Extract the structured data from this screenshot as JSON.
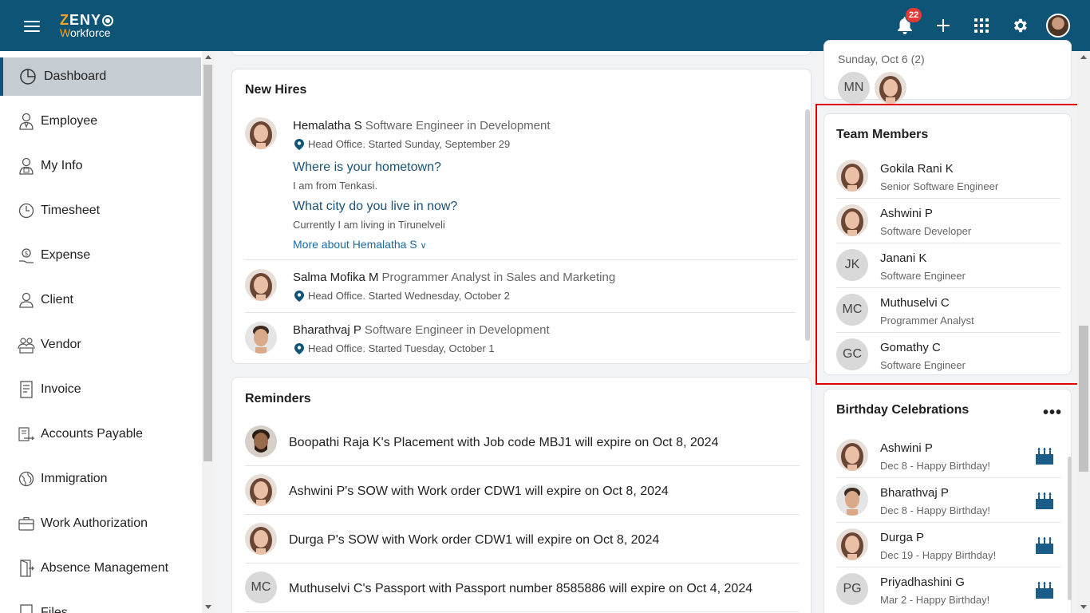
{
  "header": {
    "brand": "ZENY",
    "brand_sub": "Workforce",
    "notification_count": "22",
    "icons": [
      "menu-icon",
      "bell-icon",
      "plus-icon",
      "apps-grid-icon",
      "gear-icon",
      "user-avatar"
    ]
  },
  "sidebar": {
    "items": [
      {
        "label": "Dashboard",
        "icon": "dashboard-icon"
      },
      {
        "label": "Employee",
        "icon": "employee-icon"
      },
      {
        "label": "My Info",
        "icon": "my-info-icon"
      },
      {
        "label": "Timesheet",
        "icon": "clock-icon"
      },
      {
        "label": "Expense",
        "icon": "expense-icon"
      },
      {
        "label": "Client",
        "icon": "client-icon"
      },
      {
        "label": "Vendor",
        "icon": "vendor-icon"
      },
      {
        "label": "Invoice",
        "icon": "invoice-icon"
      },
      {
        "label": "Accounts Payable",
        "icon": "accounts-payable-icon"
      },
      {
        "label": "Immigration",
        "icon": "globe-icon"
      },
      {
        "label": "Work Authorization",
        "icon": "work-authorization-icon"
      },
      {
        "label": "Absence Management",
        "icon": "door-icon"
      },
      {
        "label": "Files",
        "icon": "files-icon"
      }
    ]
  },
  "new_hires": {
    "title": "New Hires",
    "items": [
      {
        "name": "Hemalatha S",
        "role": "Software Engineer in Development",
        "location": "Head Office. Started Sunday, September 29",
        "q1": "Where is your hometown?",
        "a1": "I am from Tenkasi.",
        "q2": "What city do you live in now?",
        "a2": "Currently I am living in Tirunelveli",
        "more": "More about Hemalatha S"
      },
      {
        "name": "Salma Mofika M",
        "role": "Programmer Analyst in Sales and Marketing",
        "location": "Head Office. Started Wednesday, October 2"
      },
      {
        "name": "Bharathvaj P",
        "role": "Software Engineer in Development",
        "location": "Head Office. Started Tuesday, October 1"
      }
    ]
  },
  "reminders": {
    "title": "Reminders",
    "items": [
      {
        "text": "Boopathi Raja K's  Placement with Job code MBJ1 will expire on Oct 8, 2024"
      },
      {
        "text": "Ashwini P's  SOW with Work order CDW1 will expire on Oct 8, 2024"
      },
      {
        "text": "Durga P's  SOW with Work order CDW1 will expire on Oct 8, 2024"
      },
      {
        "text": "Muthuselvi C's  Passport with Passport number 8585886 will expire on Oct 4, 2024",
        "initials": "MC"
      }
    ]
  },
  "upcoming": {
    "date_label": "Sunday, Oct 6 (2)",
    "initials": "MN"
  },
  "team_members": {
    "title": "Team Members",
    "items": [
      {
        "name": "Gokila Rani K",
        "role": "Senior Software Engineer"
      },
      {
        "name": "Ashwini P",
        "role": "Software Developer"
      },
      {
        "name": "Janani K",
        "role": "Software Engineer",
        "initials": "JK"
      },
      {
        "name": "Muthuselvi C",
        "role": "Programmer Analyst",
        "initials": "MC"
      },
      {
        "name": "Gomathy C",
        "role": "Software Engineer",
        "initials": "GC"
      }
    ]
  },
  "birthdays": {
    "title": "Birthday Celebrations",
    "more": "•••",
    "items": [
      {
        "name": "Ashwini P",
        "date": "Dec 8 - Happy Birthday!"
      },
      {
        "name": "Bharathvaj P",
        "date": "Dec 8 - Happy Birthday!"
      },
      {
        "name": "Durga P",
        "date": "Dec 19 - Happy Birthday!"
      },
      {
        "name": "Priyadhashini G",
        "date": "Mar 2 - Happy Birthday!",
        "initials": "PG"
      }
    ]
  },
  "colors": {
    "header_bg": "#0e5477",
    "link": "#1a5276",
    "badge": "#e53935",
    "highlight": "#e00000"
  }
}
